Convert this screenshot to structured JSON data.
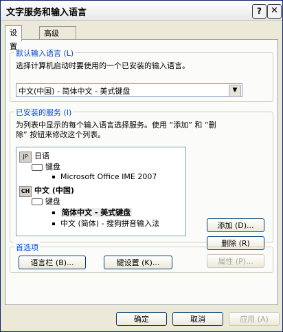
{
  "window": {
    "title": "文字服务和输入语言",
    "help_icon": "?",
    "close_icon": "✕"
  },
  "tabs": [
    {
      "label": "设置"
    },
    {
      "label": "高级"
    }
  ],
  "default_lang": {
    "legend": "默认输入语言 (L)",
    "description": "选择计算机启动时要使用的一个已安装的输入语言。",
    "selected": "中文(中国) - 简体中文 - 美式键盘",
    "arrow": "▼"
  },
  "services": {
    "legend": "已安装的服务 (I)",
    "description_1": "为列表中显示的每个输入语言选择服务。使用 “添加” 和 “删",
    "description_2": "除” 按钮来修改这个列表。",
    "tree": [
      {
        "badge": "JP",
        "label": "日语"
      },
      {
        "label": "键盘"
      },
      {
        "label": "Microsoft Office IME 2007"
      },
      {
        "badge": "CH",
        "label": "中文 (中国)"
      },
      {
        "label": "键盘"
      },
      {
        "label": "简体中文 - 美式键盘"
      },
      {
        "label": "中文 (简体) - 搜狗拼音输入法"
      }
    ],
    "add_button": "添加 (D)...",
    "remove_button": "删除 (R)",
    "properties_button": "属性 (P)..."
  },
  "prefs": {
    "legend": "首选项",
    "langbar_button": "语言栏 (B)...",
    "keysettings_button": "键设置 (K)..."
  },
  "footer": {
    "ok": "确定",
    "cancel": "取消",
    "apply": "应用 (A)"
  }
}
